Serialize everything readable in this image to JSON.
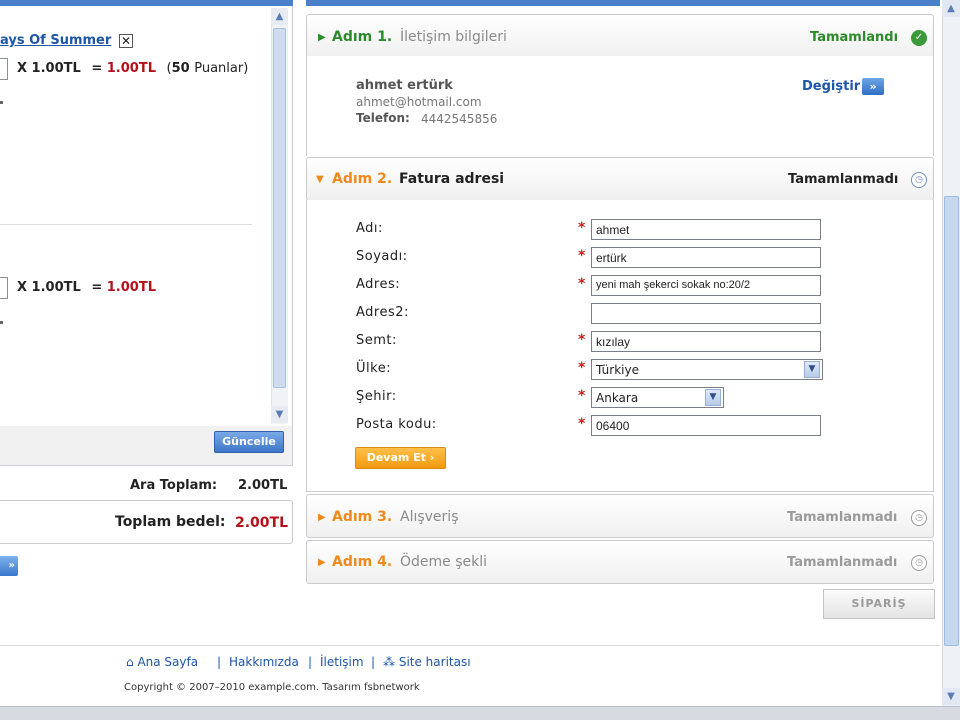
{
  "cart": {
    "item1": {
      "name": "ays Of Summer",
      "remove": "✕",
      "qty_text": "X 1.00TL",
      "equals": "=",
      "price": "1.00TL",
      "points_open": "(",
      "points_value": "50",
      "points_label": "Puanlar)"
    },
    "item2": {
      "qty_text": "X 1.00TL",
      "equals": "=",
      "price": "1.00TL"
    },
    "update_button": "Güncelle",
    "subtotal_label": "Ara Toplam:",
    "subtotal_value": "2.00TL",
    "total_label": "Toplam bedel:",
    "total_value": "2.00TL",
    "arrow_button": "»"
  },
  "steps": {
    "step1": {
      "label": "Adım 1.",
      "title": "İletişim bilgileri",
      "status": "Tamamlandı",
      "contact_name": "ahmet ertürk",
      "contact_email": "ahmet@hotmail.com",
      "phone_label": "Telefon:",
      "phone_value": "4442545856",
      "change_link": "Değiştir",
      "change_icon": "»"
    },
    "step2": {
      "label": "Adım 2.",
      "title": "Fatura adresi",
      "status": "Tamamlanmadı",
      "fields": [
        {
          "label": "Adı:",
          "required": "*",
          "value": "ahmet"
        },
        {
          "label": "Soyadı:",
          "required": "*",
          "value": "ertürk"
        },
        {
          "label": "Adres:",
          "required": "*",
          "value": "yeni mah şekerci sokak no:20/2"
        },
        {
          "label": "Adres2:",
          "required": "",
          "value": ""
        },
        {
          "label": "Semt:",
          "required": "*",
          "value": "kızılay"
        },
        {
          "label": "Ülke:",
          "required": "*",
          "value": "Türkiye"
        },
        {
          "label": "Şehir:",
          "required": "*",
          "value": "Ankara"
        },
        {
          "label": "Posta kodu:",
          "required": "*",
          "value": "06400"
        }
      ],
      "continue_button": "Devam Et ›"
    },
    "step3": {
      "label": "Adım 3.",
      "title": "Alışveriş",
      "status": "Tamamlanmadı"
    },
    "step4": {
      "label": "Adım 4.",
      "title": "Ödeme şekli",
      "status": "Tamamlanmadı"
    }
  },
  "order_button": "SİPARİŞ",
  "footer": {
    "links": [
      "Ana Sayfa",
      "Hakkımızda",
      "İletişim",
      "Site haritası"
    ],
    "separator": "|",
    "copyright": "Copyright © 2007–2010 example.com.  Tasarım fsbnetwork"
  },
  "icons": {
    "home": "home-icon",
    "sitemap": "sitemap-icon",
    "done": "check-icon",
    "pending": "clock-icon"
  },
  "colors": {
    "accent_blue": "#4a7fc9",
    "link_blue": "#1d55a8",
    "done_green": "#2c8a2c",
    "step_orange": "#ef8a1a",
    "price_red": "#b3121a"
  }
}
